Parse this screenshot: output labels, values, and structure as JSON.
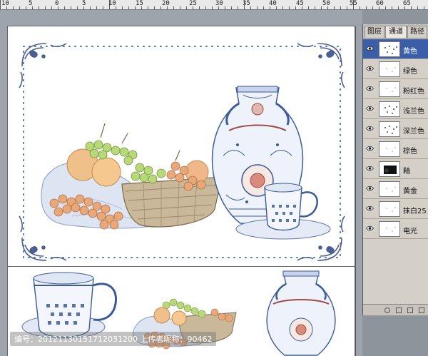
{
  "ruler": {
    "numbers": [
      "10",
      "5",
      "0",
      "5",
      "10",
      "15",
      "20",
      "25",
      "30",
      "35",
      "40",
      "45",
      "50",
      "55",
      "60",
      "65"
    ]
  },
  "layers_panel": {
    "tabs": [
      {
        "label": "图层",
        "active": false
      },
      {
        "label": "通道",
        "active": true
      },
      {
        "label": "路径",
        "active": false
      }
    ],
    "layers": [
      {
        "name": "黄色",
        "selected": true,
        "thumb": "scatter"
      },
      {
        "name": "绿色",
        "selected": false,
        "thumb": "light"
      },
      {
        "name": "粉红色",
        "selected": false,
        "thumb": "light"
      },
      {
        "name": "浅兰色",
        "selected": false,
        "thumb": "scatter"
      },
      {
        "name": "深兰色",
        "selected": false,
        "thumb": "scatter"
      },
      {
        "name": "棕色",
        "selected": false,
        "thumb": "light"
      },
      {
        "name": "釉",
        "selected": false,
        "thumb": "dark"
      },
      {
        "name": "黄金",
        "selected": false,
        "thumb": "light"
      },
      {
        "name": "抹白25",
        "selected": false,
        "thumb": "light"
      },
      {
        "name": "电光",
        "selected": false,
        "thumb": "light"
      }
    ]
  },
  "watermark": {
    "text": "编号：20121130151712031200  上传者昵称：90462"
  },
  "colors": {
    "selection": "#3a5ea8",
    "porcelain_blue": "#3d5b9a",
    "fruit_orange": "#d9925a",
    "grape_green": "#9bc25a"
  }
}
